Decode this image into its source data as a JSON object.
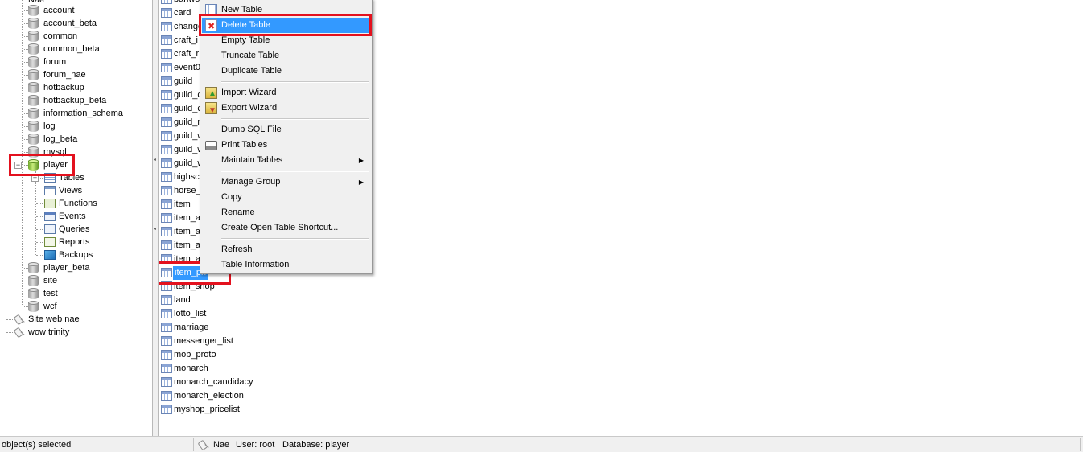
{
  "tree": {
    "partial_top_label": "Nae",
    "databases_before": [
      "account",
      "account_beta",
      "common",
      "common_beta",
      "forum",
      "forum_nae",
      "hotbackup",
      "hotbackup_beta",
      "information_schema",
      "log",
      "log_beta",
      "mysql"
    ],
    "open_database": "player",
    "player_children": [
      "Tables",
      "Views",
      "Functions",
      "Events",
      "Queries",
      "Reports",
      "Backups"
    ],
    "databases_after": [
      "player_beta",
      "site",
      "test",
      "wcf"
    ],
    "connections": [
      "Site web nae",
      "wow trinity"
    ]
  },
  "tables": {
    "rows": [
      "banwo",
      "card",
      "change",
      "craft_i",
      "craft_r",
      "event0",
      "guild",
      "guild_c",
      "guild_c",
      "guild_m",
      "guild_w",
      "guild_w",
      "guild_w",
      "highsco",
      "horse_",
      "item",
      "item_a",
      "item_a",
      "item_a",
      "item_a",
      "item_pri",
      "item_shop",
      "land",
      "lotto_list",
      "marriage",
      "messenger_list",
      "mob_proto",
      "monarch",
      "monarch_candidacy",
      "monarch_election",
      "myshop_pricelist"
    ],
    "selected_index": 20
  },
  "context_menu": {
    "groups": [
      [
        {
          "label": "New Table",
          "icon": "new-table-icon"
        },
        {
          "label": "Delete Table",
          "icon": "delete-table-icon",
          "active": true
        },
        {
          "label": "Empty Table"
        },
        {
          "label": "Truncate Table"
        },
        {
          "label": "Duplicate Table"
        }
      ],
      [
        {
          "label": "Import Wizard",
          "icon": "import-wizard-icon"
        },
        {
          "label": "Export Wizard",
          "icon": "export-wizard-icon"
        }
      ],
      [
        {
          "label": "Dump SQL File"
        },
        {
          "label": "Print Tables",
          "icon": "printer-icon"
        },
        {
          "label": "Maintain Tables",
          "submenu": true
        }
      ],
      [
        {
          "label": "Manage Group",
          "submenu": true
        },
        {
          "label": "Copy"
        },
        {
          "label": "Rename"
        },
        {
          "label": "Create Open Table Shortcut..."
        }
      ],
      [
        {
          "label": "Refresh"
        },
        {
          "label": "Table Information"
        }
      ]
    ]
  },
  "statusbar": {
    "selection_text": "object(s) selected",
    "connection": "Nae",
    "user_text": "User: root",
    "database_text": "Database: player"
  },
  "colors": {
    "highlight": "#e3111e",
    "selection": "#3399ff",
    "menu_bg": "#f0f0f0"
  }
}
